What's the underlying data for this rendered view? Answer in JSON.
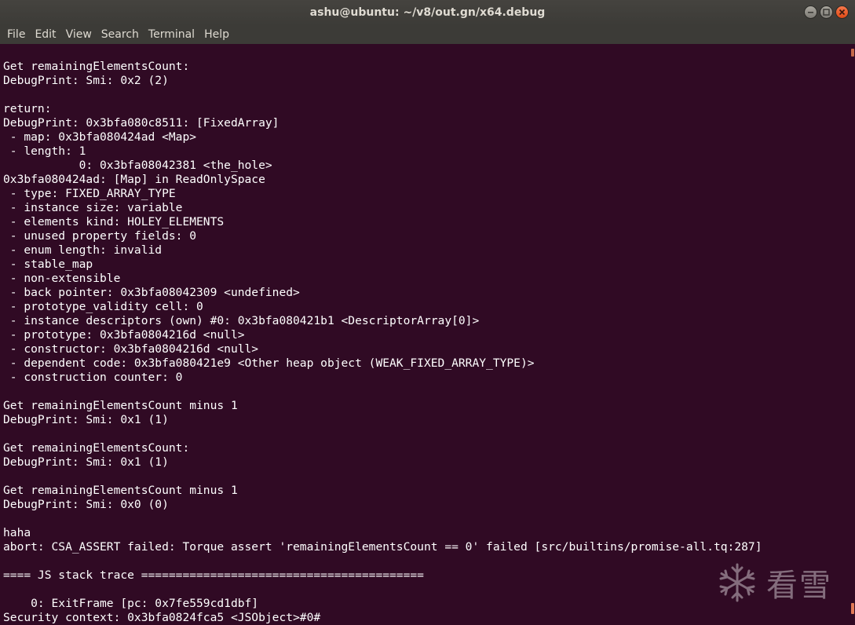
{
  "window": {
    "title": "ashu@ubuntu: ~/v8/out.gn/x64.debug",
    "controls": {
      "minimize_icon": "minimize-icon",
      "maximize_icon": "maximize-icon",
      "close_icon": "close-icon"
    }
  },
  "menubar": {
    "items": [
      "File",
      "Edit",
      "View",
      "Search",
      "Terminal",
      "Help"
    ]
  },
  "terminal": {
    "lines": [
      "Get remainingElementsCount:",
      "DebugPrint: Smi: 0x2 (2)",
      "",
      "return:",
      "DebugPrint: 0x3bfa080c8511: [FixedArray]",
      " - map: 0x3bfa080424ad <Map>",
      " - length: 1",
      "           0: 0x3bfa08042381 <the_hole>",
      "0x3bfa080424ad: [Map] in ReadOnlySpace",
      " - type: FIXED_ARRAY_TYPE",
      " - instance size: variable",
      " - elements kind: HOLEY_ELEMENTS",
      " - unused property fields: 0",
      " - enum length: invalid",
      " - stable_map",
      " - non-extensible",
      " - back pointer: 0x3bfa08042309 <undefined>",
      " - prototype_validity cell: 0",
      " - instance descriptors (own) #0: 0x3bfa080421b1 <DescriptorArray[0]>",
      " - prototype: 0x3bfa0804216d <null>",
      " - constructor: 0x3bfa0804216d <null>",
      " - dependent code: 0x3bfa080421e9 <Other heap object (WEAK_FIXED_ARRAY_TYPE)>",
      " - construction counter: 0",
      "",
      "Get remainingElementsCount minus 1",
      "DebugPrint: Smi: 0x1 (1)",
      "",
      "Get remainingElementsCount:",
      "DebugPrint: Smi: 0x1 (1)",
      "",
      "Get remainingElementsCount minus 1",
      "DebugPrint: Smi: 0x0 (0)",
      "",
      "haha",
      "abort: CSA_ASSERT failed: Torque assert 'remainingElementsCount == 0' failed [src/builtins/promise-all.tq:287]",
      "",
      "==== JS stack trace =========================================",
      "",
      "    0: ExitFrame [pc: 0x7fe559cd1dbf]",
      "Security context: 0x3bfa0824fca5 <JSObject>#0#"
    ]
  },
  "watermark": {
    "text": "看雪",
    "icon": "snowflake-logo-icon"
  },
  "colors": {
    "terminal_bg": "#300a24",
    "terminal_fg": "#ffffff",
    "titlebar_bg": "#3c3b37",
    "close_button": "#df4a16"
  }
}
